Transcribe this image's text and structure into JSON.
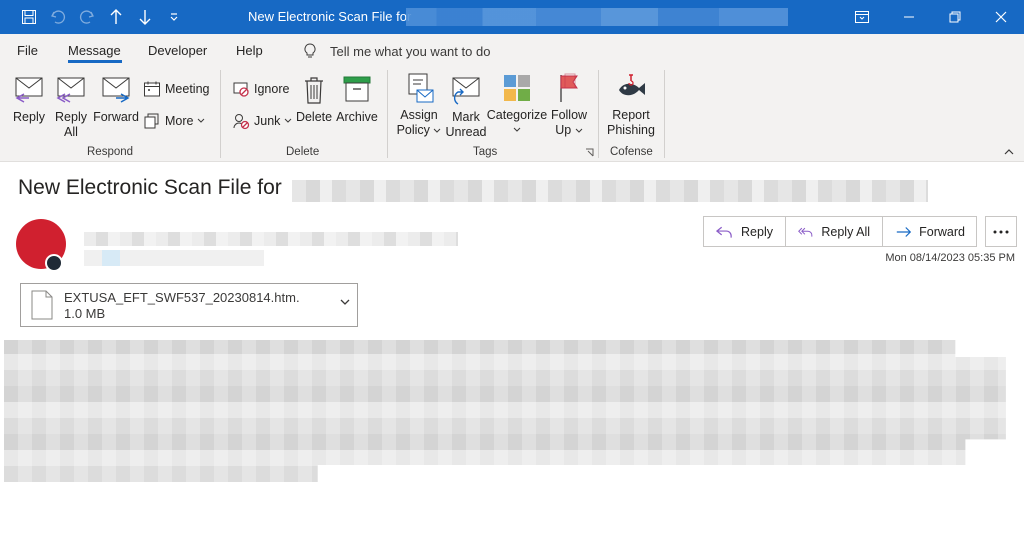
{
  "titlebar": {
    "title": "New Electronic Scan File for"
  },
  "menu": {
    "tabs": [
      "File",
      "Message",
      "Developer",
      "Help"
    ],
    "active": "Message",
    "tell_me": "Tell me what you want to do"
  },
  "ribbon": {
    "respond": {
      "label": "Respond",
      "reply": "Reply",
      "reply_all_1": "Reply",
      "reply_all_2": "All",
      "forward": "Forward",
      "meeting": "Meeting",
      "more": "More"
    },
    "delete": {
      "label": "Delete",
      "ignore": "Ignore",
      "junk": "Junk",
      "delete": "Delete",
      "archive": "Archive"
    },
    "tags": {
      "label": "Tags",
      "assign_1": "Assign",
      "assign_2": "Policy",
      "mark_1": "Mark",
      "mark_2": "Unread",
      "categorize": "Categorize",
      "follow_1": "Follow",
      "follow_2": "Up"
    },
    "cofense": {
      "label": "Cofense",
      "report_1": "Report",
      "report_2": "Phishing"
    }
  },
  "message": {
    "subject": "New Electronic Scan File for",
    "actions": {
      "reply": "Reply",
      "reply_all": "Reply All",
      "forward": "Forward"
    },
    "timestamp": "Mon 08/14/2023 05:35 PM",
    "attachment": {
      "name": "EXTUSA_EFT_SWF537_20230814.htm.",
      "size": "1.0 MB"
    }
  },
  "colors": {
    "title_bar": "#1769c4",
    "ribbon_bg": "#f3f2f1",
    "avatar": "#d0202f",
    "accent": "#1769c4"
  }
}
